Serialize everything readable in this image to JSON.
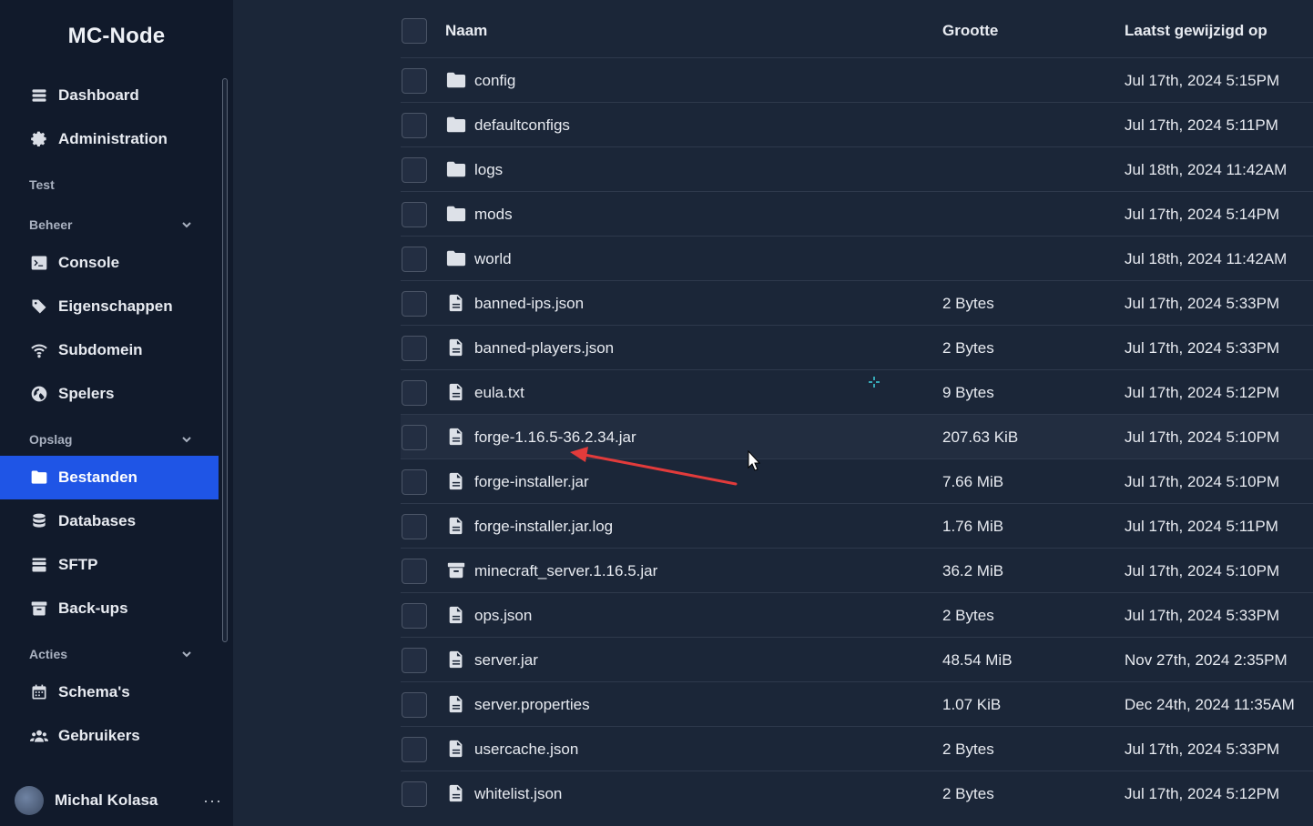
{
  "sidebar": {
    "brand": "MC-Node",
    "top_items": [
      {
        "label": "Dashboard",
        "icon": "dashboard-icon"
      },
      {
        "label": "Administration",
        "icon": "gear-icon"
      }
    ],
    "test_label": "Test",
    "beheer": {
      "label": "Beheer",
      "items": [
        {
          "label": "Console",
          "icon": "terminal-icon"
        },
        {
          "label": "Eigenschappen",
          "icon": "tag-icon"
        },
        {
          "label": "Subdomein",
          "icon": "wifi-icon"
        },
        {
          "label": "Spelers",
          "icon": "globe-icon"
        }
      ]
    },
    "opslag": {
      "label": "Opslag",
      "items": [
        {
          "label": "Bestanden",
          "icon": "folder-icon",
          "active": true
        },
        {
          "label": "Databases",
          "icon": "database-icon"
        },
        {
          "label": "SFTP",
          "icon": "server-icon"
        },
        {
          "label": "Back-ups",
          "icon": "archive-icon"
        }
      ]
    },
    "acties": {
      "label": "Acties",
      "items": [
        {
          "label": "Schema's",
          "icon": "calendar-icon"
        },
        {
          "label": "Gebruikers",
          "icon": "users-icon"
        }
      ]
    },
    "user": {
      "name": "Michal Kolasa",
      "more": "···"
    }
  },
  "table": {
    "headers": {
      "name": "Naam",
      "size": "Grootte",
      "modified": "Laatst gewijzigd op"
    },
    "rows": [
      {
        "type": "folder",
        "name": "config",
        "size": "",
        "modified": "Jul 17th, 2024 5:15PM"
      },
      {
        "type": "folder",
        "name": "defaultconfigs",
        "size": "",
        "modified": "Jul 17th, 2024 5:11PM"
      },
      {
        "type": "folder",
        "name": "logs",
        "size": "",
        "modified": "Jul 18th, 2024 11:42AM"
      },
      {
        "type": "folder",
        "name": "mods",
        "size": "",
        "modified": "Jul 17th, 2024 5:14PM"
      },
      {
        "type": "folder",
        "name": "world",
        "size": "",
        "modified": "Jul 18th, 2024 11:42AM"
      },
      {
        "type": "file",
        "name": "banned-ips.json",
        "size": "2 Bytes",
        "modified": "Jul 17th, 2024 5:33PM"
      },
      {
        "type": "file",
        "name": "banned-players.json",
        "size": "2 Bytes",
        "modified": "Jul 17th, 2024 5:33PM"
      },
      {
        "type": "file",
        "name": "eula.txt",
        "size": "9 Bytes",
        "modified": "Jul 17th, 2024 5:12PM"
      },
      {
        "type": "file",
        "name": "forge-1.16.5-36.2.34.jar",
        "size": "207.63 KiB",
        "modified": "Jul 17th, 2024 5:10PM",
        "hover": true
      },
      {
        "type": "file",
        "name": "forge-installer.jar",
        "size": "7.66 MiB",
        "modified": "Jul 17th, 2024 5:10PM"
      },
      {
        "type": "file",
        "name": "forge-installer.jar.log",
        "size": "1.76 MiB",
        "modified": "Jul 17th, 2024 5:11PM"
      },
      {
        "type": "archive",
        "name": "minecraft_server.1.16.5.jar",
        "size": "36.2 MiB",
        "modified": "Jul 17th, 2024 5:10PM"
      },
      {
        "type": "file",
        "name": "ops.json",
        "size": "2 Bytes",
        "modified": "Jul 17th, 2024 5:33PM"
      },
      {
        "type": "file",
        "name": "server.jar",
        "size": "48.54 MiB",
        "modified": "Nov 27th, 2024 2:35PM"
      },
      {
        "type": "file",
        "name": "server.properties",
        "size": "1.07 KiB",
        "modified": "Dec 24th, 2024 11:35AM"
      },
      {
        "type": "file",
        "name": "usercache.json",
        "size": "2 Bytes",
        "modified": "Jul 17th, 2024 5:33PM"
      },
      {
        "type": "file",
        "name": "whitelist.json",
        "size": "2 Bytes",
        "modified": "Jul 17th, 2024 5:12PM"
      }
    ]
  },
  "colors": {
    "accent": "#1f55e6",
    "annotation_arrow": "#e23b3b",
    "background": "#1b2638",
    "sidebar": "#111a2b"
  }
}
